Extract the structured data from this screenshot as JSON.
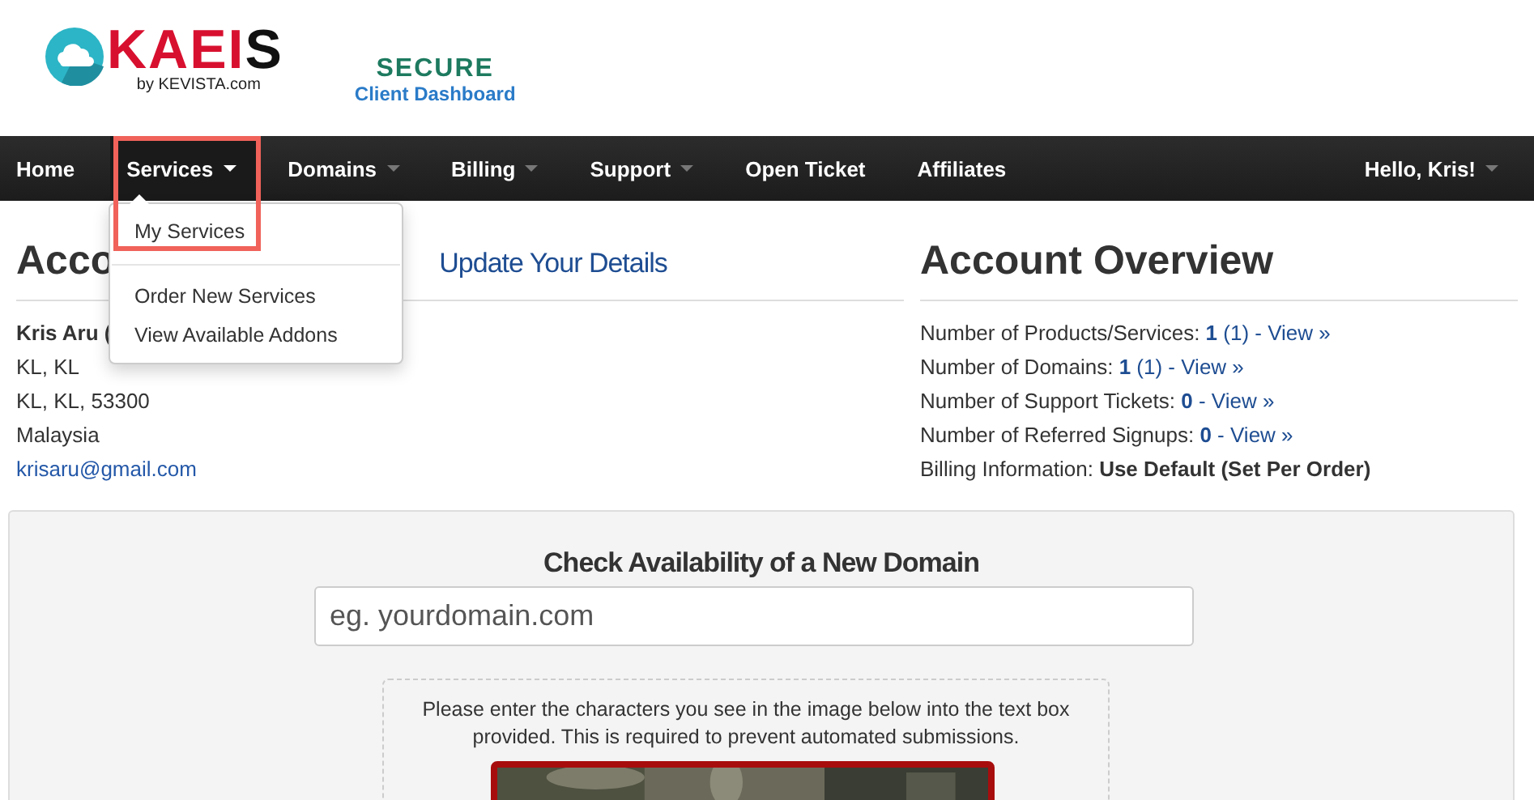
{
  "logo": {
    "name_red": "KAEI",
    "name_dark": "S",
    "tagline": "by KEVISTA.com"
  },
  "secure_badge": {
    "line_1": "SECURE",
    "line_2": "Client Dashboard"
  },
  "nav": {
    "items": [
      {
        "label": "Home",
        "dropdown": false,
        "open": false,
        "highlighted": false
      },
      {
        "label": "Services",
        "dropdown": true,
        "open": true,
        "highlighted": true
      },
      {
        "label": "Domains",
        "dropdown": true,
        "open": false,
        "highlighted": false
      },
      {
        "label": "Billing",
        "dropdown": true,
        "open": false,
        "highlighted": false
      },
      {
        "label": "Support",
        "dropdown": true,
        "open": false,
        "highlighted": false
      },
      {
        "label": "Open Ticket",
        "dropdown": false,
        "open": false,
        "highlighted": false
      },
      {
        "label": "Affiliates",
        "dropdown": false,
        "open": false,
        "highlighted": false
      }
    ],
    "user_menu": {
      "label": "Hello, Kris!",
      "dropdown": true
    }
  },
  "dropdown_menu": {
    "groups": [
      [
        "My Services"
      ],
      [
        "Order New Services",
        "View Available Addons"
      ]
    ]
  },
  "account": {
    "heading": "Acco",
    "update_link": "Update Your Details",
    "lines": [
      {
        "text": "Kris Aru (",
        "kind": "bold"
      },
      {
        "text": "KL, KL",
        "kind": "plain"
      },
      {
        "text": "KL, KL, 53300",
        "kind": "plain"
      },
      {
        "text": "Malaysia",
        "kind": "plain"
      },
      {
        "text": "krisaru@gmail.com",
        "kind": "link"
      }
    ]
  },
  "overview": {
    "heading": "Account Overview",
    "rows": [
      {
        "label": "Number of Products/Services:",
        "count": "1",
        "extra": " (1) - View »",
        "kind": "link"
      },
      {
        "label": "Number of Domains:",
        "count": "1",
        "extra": " (1) - View »",
        "kind": "link"
      },
      {
        "label": "Number of Support Tickets:",
        "count": "0",
        "extra": " - View »",
        "kind": "link"
      },
      {
        "label": "Number of Referred Signups:",
        "count": "0",
        "extra": " - View »",
        "kind": "link"
      },
      {
        "label": "Billing Information:",
        "count": "Use Default (Set Per Order)",
        "extra": "",
        "kind": "plain"
      }
    ]
  },
  "domain_check": {
    "title": "Check Availability of a New Domain",
    "placeholder": "eg. yourdomain.com",
    "captcha_note": "Please enter the characters you see in the image below into the text box provided. This is required to prevent automated submissions."
  }
}
